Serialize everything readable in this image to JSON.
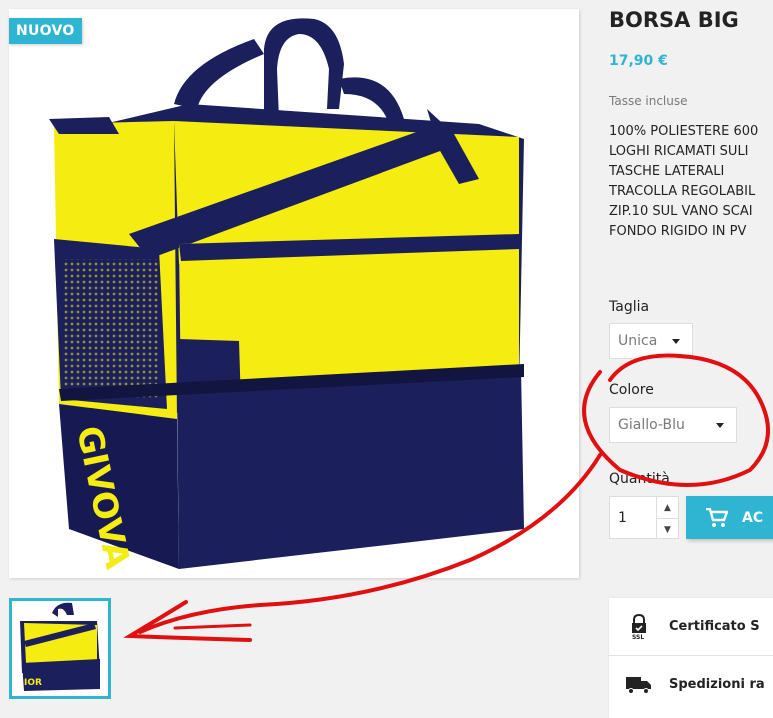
{
  "product": {
    "badge": "NUOVO",
    "title": "BORSA BIG",
    "price": "17,90 €",
    "tax_note": "Tasse incluse",
    "description_lines": [
      "100% POLIESTERE 600",
      "LOGHI RICAMATI SULI",
      "TASCHE LATERALI",
      "TRACOLLA REGOLABIL",
      "ZIP.10 SUL VANO SCAI",
      "FONDO RIGIDO IN PV"
    ],
    "bag_brand_text": "GIVOVA"
  },
  "variants": {
    "size_label": "Taglia",
    "size_value": "Unica",
    "color_label": "Colore",
    "color_value": "Giallo-Blu"
  },
  "quantity": {
    "label": "Quantità",
    "value": "1",
    "up_icon": "chevron-up-icon",
    "down_icon": "chevron-down-icon"
  },
  "cart": {
    "add_label": "AC",
    "icon": "cart-icon"
  },
  "reassurance": {
    "items": [
      {
        "label": "Certificato S",
        "icon": "lock-ssl-icon"
      },
      {
        "label": "Spedizioni ra",
        "icon": "truck-icon"
      }
    ]
  },
  "colors": {
    "accent": "#2fb5d2",
    "bag_yellow": "#f5ec12",
    "bag_navy": "#1b1f5c",
    "annotation_red": "#e01010"
  }
}
